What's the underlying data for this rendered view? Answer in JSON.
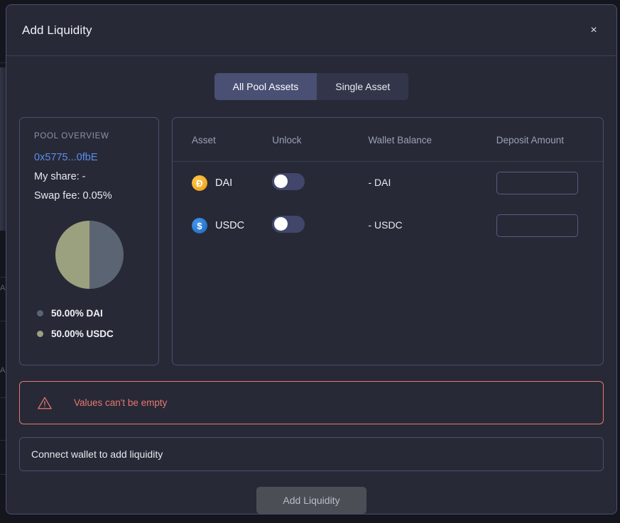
{
  "backdrop": {
    "hint_labels": [
      "A",
      "A"
    ]
  },
  "modal": {
    "title": "Add Liquidity",
    "close_label": "×",
    "close_icon": "close-icon"
  },
  "tabs": [
    {
      "label": "All Pool Assets",
      "active": true
    },
    {
      "label": "Single Asset",
      "active": false
    }
  ],
  "pool_overview": {
    "section_label": "POOL OVERVIEW",
    "address": "0x5775...0fbE",
    "address_color": "#5b8def",
    "my_share": "My share: -",
    "swap_fee": "Swap fee: 0.05%"
  },
  "chart_data": {
    "type": "pie",
    "title": "",
    "legend_position": "bottom",
    "categories": [
      "DAI",
      "USDC"
    ],
    "values": [
      50.0,
      50.0
    ],
    "labels": [
      "50.00% DAI",
      "50.00% USDC"
    ],
    "colors": [
      "#5b6472",
      "#9ba07f"
    ],
    "units": "%"
  },
  "asset_table": {
    "headers": [
      "Asset",
      "Unlock",
      "Wallet Balance",
      "Deposit Amount"
    ],
    "rows": [
      {
        "symbol": "DAI",
        "icon": "dai-coin-icon",
        "icon_glyph": "Ð",
        "icon_color": "#f5a623",
        "unlocked": false,
        "wallet_balance": "- DAI",
        "deposit_value": "",
        "deposit_placeholder": ""
      },
      {
        "symbol": "USDC",
        "icon": "usdc-coin-icon",
        "icon_glyph": "$",
        "icon_color": "#2775ca",
        "unlocked": false,
        "wallet_balance": "- USDC",
        "deposit_value": "",
        "deposit_placeholder": ""
      }
    ]
  },
  "alert": {
    "message": "Values can't be empty",
    "icon": "warning-triangle-icon",
    "color": "#e8776f"
  },
  "connect_notice": {
    "message": "Connect wallet to add liquidity"
  },
  "submit": {
    "label": "Add Liquidity",
    "disabled": true
  }
}
